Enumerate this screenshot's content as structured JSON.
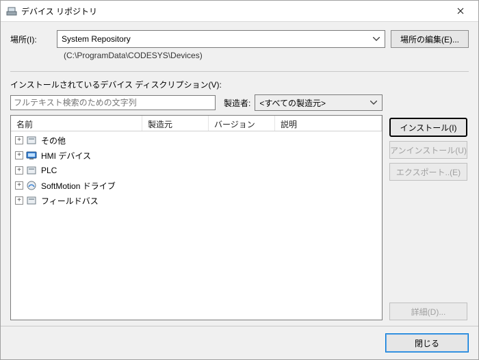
{
  "window": {
    "title": "デバイス リポジトリ"
  },
  "location": {
    "label": "場所(I):",
    "value": "System Repository",
    "path": "(C:\\ProgramData\\CODESYS\\Devices)",
    "edit_button": "場所の編集(E)..."
  },
  "installed": {
    "section_label": "インストールされているデバイス ディスクリプション(V):",
    "search_placeholder": "フルテキスト検索のための文字列",
    "vendor_label": "製造者:",
    "vendor_value": "<すべての製造元>"
  },
  "columns": {
    "name": "名前",
    "vendor": "製造元",
    "version": "バージョン",
    "desc": "説明"
  },
  "tree": [
    {
      "label": "その他",
      "icon": "device-icon"
    },
    {
      "label": "HMI デバイス",
      "icon": "hmi-icon"
    },
    {
      "label": "PLC",
      "icon": "device-icon"
    },
    {
      "label": "SoftMotion ドライブ",
      "icon": "motion-icon"
    },
    {
      "label": "フィールドバス",
      "icon": "device-icon"
    }
  ],
  "buttons": {
    "install": "インストール(I)",
    "uninstall": "アンインストール(U)",
    "export": "エクスポート..(E)",
    "details": "詳細(D)...",
    "close": "閉じる"
  }
}
